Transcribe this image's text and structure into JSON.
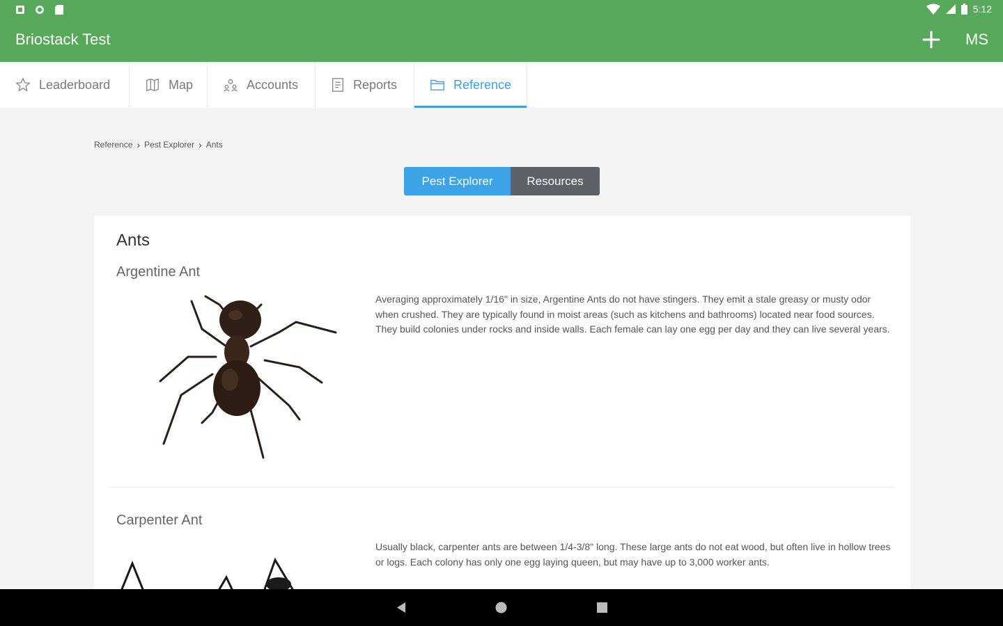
{
  "status_bar": {
    "time": "5:12"
  },
  "app_bar": {
    "title": "Briostack Test",
    "user_initials": "MS"
  },
  "tabs": [
    {
      "label": "Leaderboard"
    },
    {
      "label": "Map"
    },
    {
      "label": "Accounts"
    },
    {
      "label": "Reports"
    },
    {
      "label": "Reference"
    }
  ],
  "breadcrumb": [
    "Reference",
    "Pest Explorer",
    "Ants"
  ],
  "segmented": {
    "left": "Pest Explorer",
    "right": "Resources"
  },
  "page": {
    "title": "Ants",
    "species": [
      {
        "name": "Argentine Ant",
        "description": "Averaging approximately 1/16\" in size, Argentine Ants do not have stingers. They emit a stale greasy or musty odor when crushed. They are typically found in moist areas (such as kitchens and bathrooms) located near food sources. They build colonies under rocks and inside walls. Each female can lay one egg per day and they can live several years."
      },
      {
        "name": "Carpenter Ant",
        "description": "Usually black, carpenter ants are between 1/4-3/8\" long. These large ants do not eat wood, but often live in hollow trees or logs. Each colony has only one egg laying queen, but may have up to 3,000 worker ants."
      }
    ]
  },
  "colors": {
    "app_bar": "#57a85a",
    "accent": "#3aa0dc",
    "segment_off": "#5c6268"
  }
}
